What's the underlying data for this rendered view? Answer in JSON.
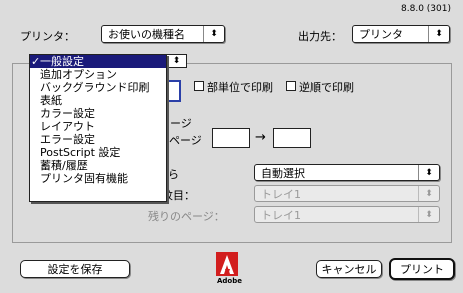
{
  "version": "8.8.0 (301)",
  "printer": {
    "label": "プリンタ：",
    "value": "お使いの機種名"
  },
  "destination": {
    "label": "出力先：",
    "value": "プリンタ"
  },
  "panel_popup": {
    "arrow": "⬍"
  },
  "menu": {
    "checkmark": "✓",
    "items": [
      {
        "label": "一般設定",
        "selected": true
      },
      {
        "label": "追加オプション"
      },
      {
        "label": "バックグラウンド印刷"
      },
      {
        "label": "表紙"
      },
      {
        "label": "カラー設定"
      },
      {
        "label": "レイアウト"
      },
      {
        "label": "エラー設定"
      },
      {
        "label": "PostScript 設定"
      },
      {
        "label": "蓄積/履歴"
      },
      {
        "label": "プリンタ固有機能"
      }
    ]
  },
  "options": {
    "collate": "部単位で印刷",
    "reverse": "逆順で印刷"
  },
  "pages": {
    "partial_label_1": "ージ",
    "partial_label_2": "Eページ",
    "arrow": "→"
  },
  "paper_source": {
    "partial_label_1": "ら",
    "auto_select": "自動選択",
    "partial_label_2": "紋目：",
    "first_page_value": "トレイ1",
    "remaining_label": "残りのページ：",
    "remaining_value": "トレイ1"
  },
  "buttons": {
    "save_settings": "設定を保存",
    "cancel": "キャンセル",
    "print": "プリント"
  },
  "logo": {
    "text": "Adobe",
    "mark": "A"
  },
  "colors": {
    "menu_highlight": "#1a1a7a",
    "logo_red": "#d21e1e"
  }
}
